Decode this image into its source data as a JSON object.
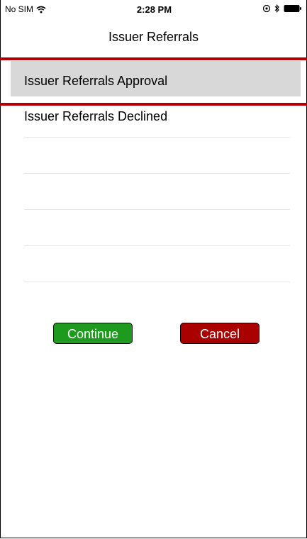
{
  "status_bar": {
    "carrier": "No SIM",
    "time": "2:28 PM",
    "icons": [
      "wifi-icon",
      "location-icon",
      "bluetooth-icon",
      "battery-icon"
    ]
  },
  "nav": {
    "title": "Issuer Referrals"
  },
  "list": {
    "items": [
      {
        "label": "Issuer Referrals Approval",
        "selected": true
      },
      {
        "label": "Issuer Referrals Declined",
        "selected": false
      }
    ],
    "highlight_color": "#b20000"
  },
  "actions": {
    "continue_label": "Continue",
    "cancel_label": "Cancel",
    "continue_color": "#1e9a1e",
    "cancel_color": "#a90000"
  }
}
